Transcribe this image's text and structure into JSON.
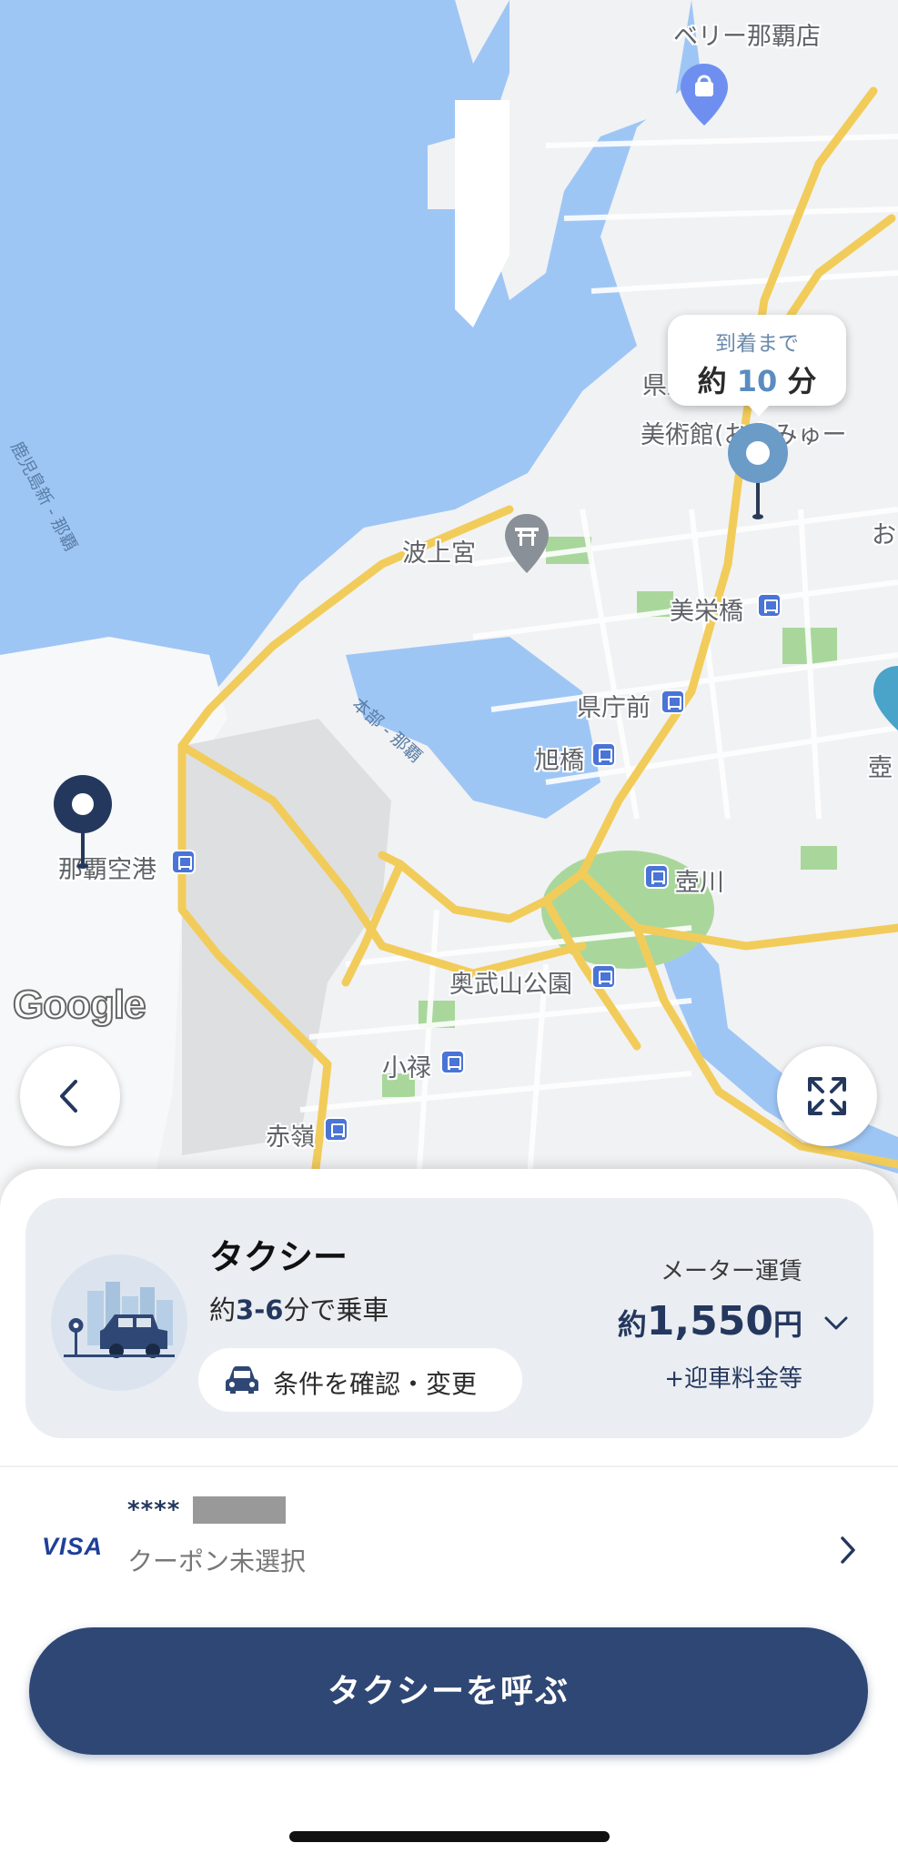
{
  "map": {
    "labels": {
      "top_store": "ベリー那覇店",
      "museum_line1": "県立博物館・",
      "museum_line2": "美術館(おきみゅー",
      "museum_edge": "お",
      "naminoue": "波上宮",
      "misaki": "美栄橋",
      "kenchomae": "県庁前",
      "asahibashi": "旭橋",
      "airport": "那覇空港",
      "tsuboya_edge": "壺",
      "tsubogawa": "壺川",
      "onoyama": "奥武山公園",
      "oroku": "小禄",
      "akamine": "赤嶺",
      "ferry_route": "鹿児島新 - 那覇",
      "harbor_route": "本部 - 那覇"
    },
    "google_logo": "Google",
    "eta": {
      "top": "到着まで",
      "prefix": "約",
      "minutes": "10",
      "unit": "分"
    }
  },
  "buttons": {
    "back_icon": "chevron-left-icon",
    "expand_icon": "expand-icon"
  },
  "ride": {
    "service_name": "タクシー",
    "pickup_prefix": "約",
    "pickup_range": "3-6",
    "pickup_suffix": "分で乗車",
    "conditions_label": "条件を確認・変更",
    "fare_label": "メーター運賃",
    "fare_prefix": "約",
    "fare_amount": "1,550",
    "fare_unit": "円",
    "fare_extra": "+迎車料金等"
  },
  "payment": {
    "brand": "VISA",
    "card_masked": "****",
    "coupon": "クーポン未選択"
  },
  "cta": {
    "label": "タクシーを呼ぶ"
  },
  "colors": {
    "primary": "#2f4774",
    "water": "#9ec6f5",
    "road": "#f2cc5a",
    "park": "#a9d79b"
  }
}
